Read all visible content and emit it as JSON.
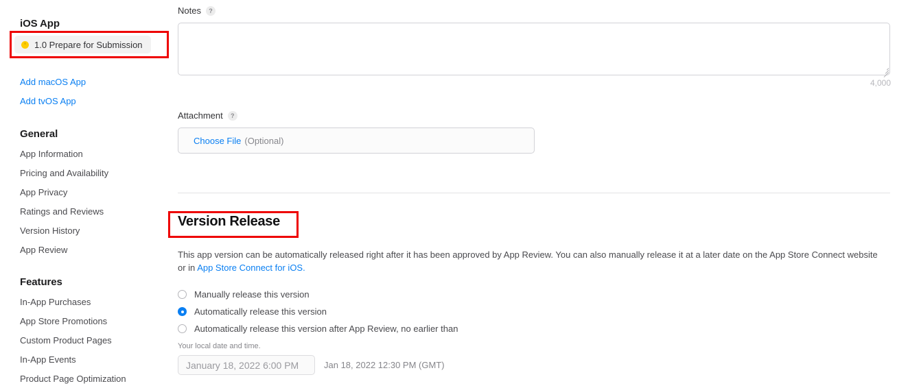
{
  "sidebar": {
    "platform_title": "iOS App",
    "version": {
      "label": "1.0 Prepare for Submission",
      "status_icon": "clock-status-icon",
      "status_color": "#ffcc00",
      "highlighted": true
    },
    "add_links": [
      {
        "label": "Add macOS App"
      },
      {
        "label": "Add tvOS App"
      }
    ],
    "sections": [
      {
        "heading": "General",
        "items": [
          {
            "label": "App Information"
          },
          {
            "label": "Pricing and Availability"
          },
          {
            "label": "App Privacy"
          },
          {
            "label": "Ratings and Reviews"
          },
          {
            "label": "Version History"
          },
          {
            "label": "App Review"
          }
        ]
      },
      {
        "heading": "Features",
        "items": [
          {
            "label": "In-App Purchases"
          },
          {
            "label": "App Store Promotions"
          },
          {
            "label": "Custom Product Pages"
          },
          {
            "label": "In-App Events"
          },
          {
            "label": "Product Page Optimization"
          }
        ]
      }
    ]
  },
  "main": {
    "notes": {
      "label": "Notes",
      "help_icon": "?",
      "value": "",
      "char_limit": "4,000"
    },
    "attachment": {
      "label": "Attachment",
      "help_icon": "?",
      "choose_file_label": "Choose File",
      "optional_label": "(Optional)"
    },
    "version_release": {
      "title": "Version Release",
      "highlighted": true,
      "description_part1": "This app version can be automatically released right after it has been approved by App Review. You can also manually release it at a later date on the App Store Connect website or in ",
      "description_link": "App Store Connect for iOS.",
      "options": [
        {
          "label": "Manually release this version",
          "selected": false
        },
        {
          "label": "Automatically release this version",
          "selected": true
        },
        {
          "label": "Automatically release this version after App Review, no earlier than",
          "selected": false
        }
      ],
      "local_time_caption": "Your local date and time.",
      "date_value": "January 18, 2022 6:00 PM",
      "gmt_text": "Jan 18, 2022 12:30 PM (GMT)"
    }
  },
  "colors": {
    "accent_link": "#0a7ff2",
    "annotation_red": "#ee0000",
    "status_yellow": "#ffcc00"
  }
}
